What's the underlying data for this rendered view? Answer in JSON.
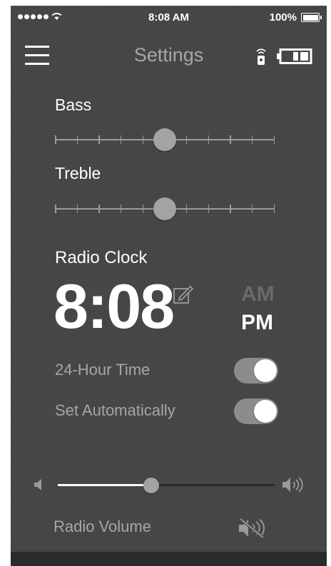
{
  "status_bar": {
    "time": "8:08 AM",
    "battery_text": "100%",
    "signal_dots": 5
  },
  "header": {
    "title": "Settings",
    "menu_icon": "hamburger-menu-icon",
    "remote_icon": "remote-control-icon",
    "device_battery_icon": "device-battery-icon"
  },
  "bass": {
    "label": "Bass",
    "ticks": 11,
    "value_fraction": 0.5
  },
  "treble": {
    "label": "Treble",
    "ticks": 11,
    "value_fraction": 0.5
  },
  "clock": {
    "label": "Radio Clock",
    "time": "8:08",
    "am_label": "AM",
    "pm_label": "PM",
    "selected_period": "PM"
  },
  "toggles": {
    "hour24": {
      "label": "24-Hour Time",
      "on": true
    },
    "auto": {
      "label": "Set Automatically",
      "on": true
    }
  },
  "volume": {
    "label": "Radio Volume",
    "value_fraction": 0.43,
    "mute_icon": "speaker-muted-icon"
  },
  "colors": {
    "background": "#454545",
    "text_primary": "#ffffff",
    "text_secondary": "#a6a6a6",
    "knob": "#a3a3a6",
    "toggle_on": "#8c8c8c"
  }
}
